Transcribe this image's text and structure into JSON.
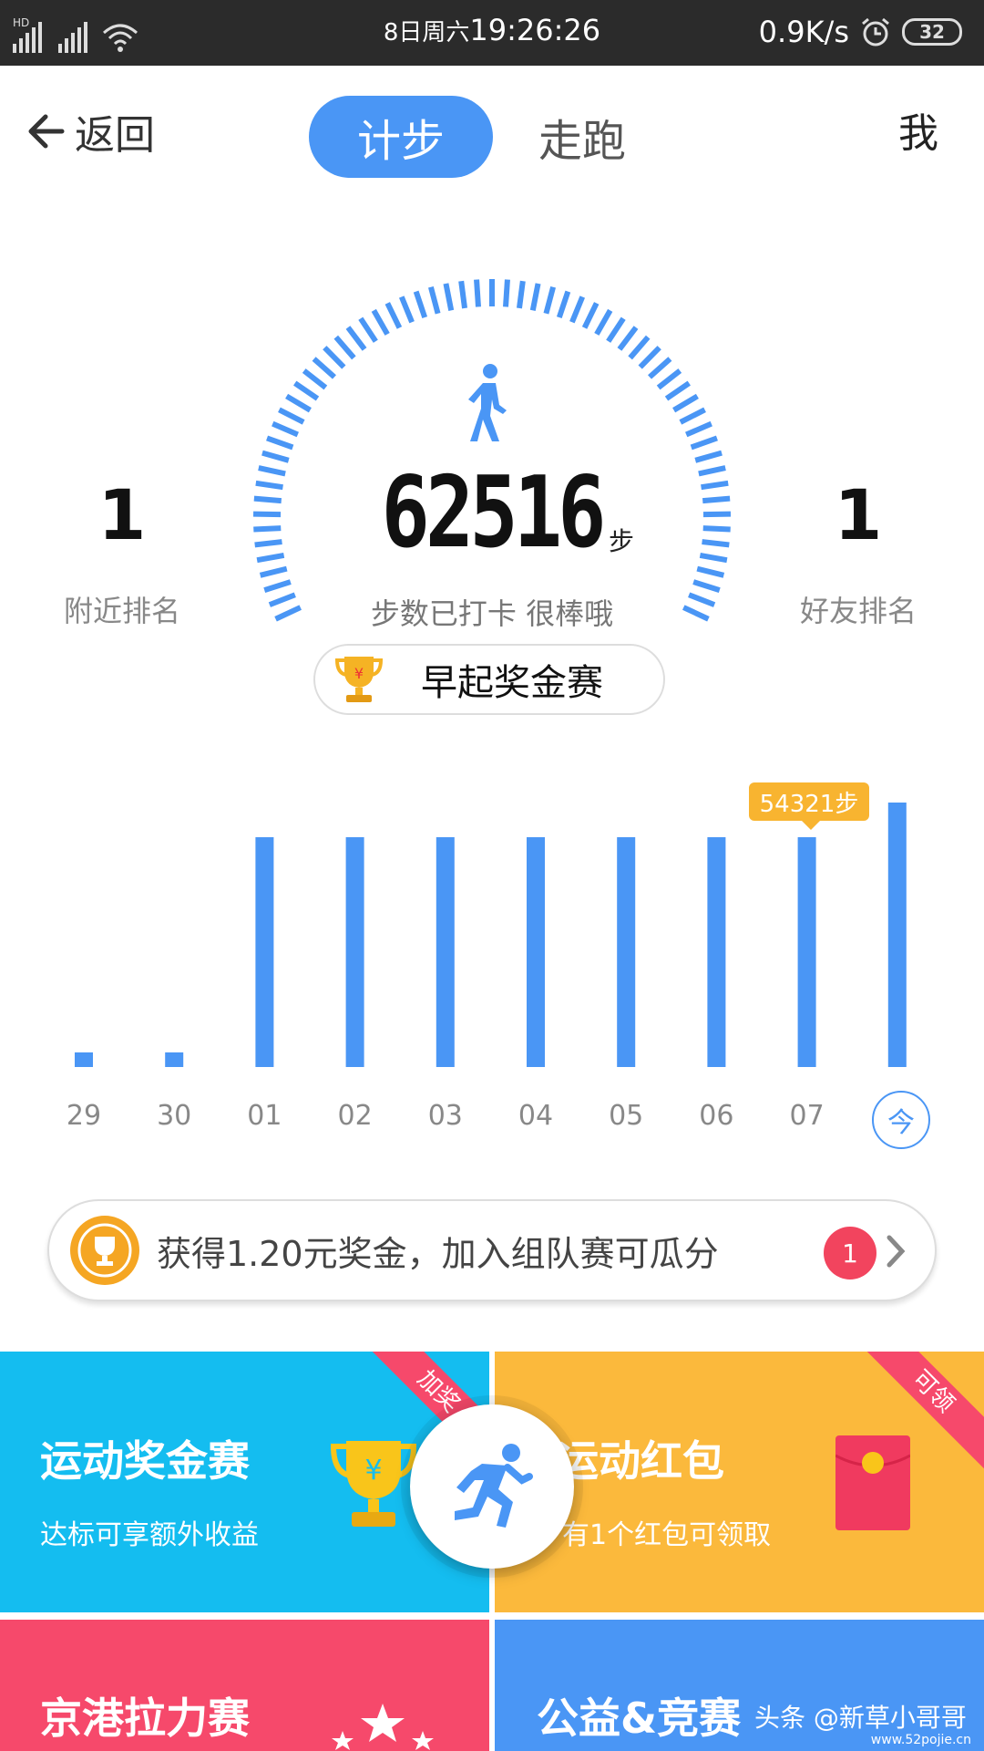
{
  "status_bar": {
    "network_tag": "HD",
    "datetime_prefix": "8日周六",
    "time": "19:26:26",
    "speed": "0.9K/s",
    "battery": "32"
  },
  "nav": {
    "back_label": "返回",
    "tabs": [
      {
        "label": "计步",
        "active": true
      },
      {
        "label": "走跑",
        "active": false
      }
    ],
    "me_label": "我"
  },
  "summary": {
    "steps": "62516",
    "steps_unit": "步",
    "steps_sub": "步数已打卡   很棒哦",
    "nearby_rank": "1",
    "nearby_rank_label": "附近排名",
    "friend_rank": "1",
    "friend_rank_label": "好友排名"
  },
  "early_bird": {
    "label": "早起奖金赛"
  },
  "chart_data": {
    "type": "bar",
    "categories": [
      "29",
      "30",
      "01",
      "02",
      "03",
      "04",
      "05",
      "06",
      "07",
      "今"
    ],
    "values": [
      1500,
      1500,
      54321,
      54321,
      54321,
      54321,
      54321,
      54321,
      54321,
      62516
    ],
    "tooltip": {
      "index": 8,
      "label": "54321步"
    },
    "color": "#4a96f5",
    "ylim": [
      0,
      62516
    ],
    "grid": false,
    "legend": "none"
  },
  "bonus": {
    "text": "获得1.20元奖金，加入组队赛可瓜分",
    "badge_count": "1"
  },
  "cards": [
    {
      "title": "运动奖金赛",
      "subtitle": "达标可享额外收益",
      "ribbon": "加奖",
      "color": "#14bdf0",
      "icon": "trophy-icon"
    },
    {
      "title": "运动红包",
      "subtitle": "有1个红包可领取",
      "ribbon": "可领",
      "color": "#fbb93c",
      "icon": "red-packet-icon"
    },
    {
      "title": "京港拉力赛",
      "color": "#f6496b",
      "icon": "stars-icon"
    },
    {
      "title": "公益&竞赛",
      "color": "#4a96f5"
    }
  ],
  "watermark": "头条 @新草小哥哥",
  "watermark_url": "www.52pojie.cn",
  "colors": {
    "accent": "#4a96f5",
    "tooltip": "#f8b430",
    "badge": "#f2445e"
  }
}
